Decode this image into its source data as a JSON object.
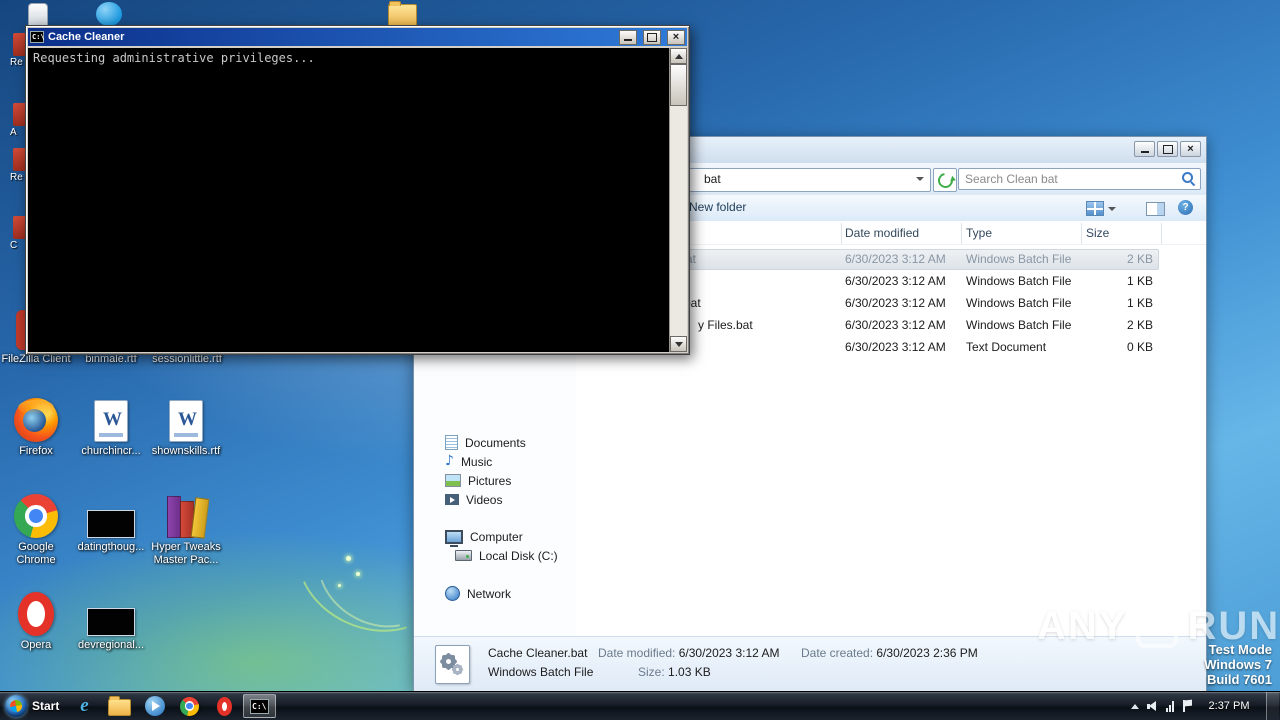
{
  "desktop": {
    "test_mode": {
      "l1": "Test Mode",
      "l2": "Windows 7",
      "l3": "Build 7601"
    },
    "watermark": {
      "left": "ANY",
      "right": "RUN"
    },
    "edge_fragments": [
      "Re",
      "A",
      "Re",
      "C"
    ],
    "icons": [
      {
        "label": "FileZilla Client",
        "icon": "filezilla-icon"
      },
      {
        "label": "binmale.rtf",
        "icon": "rtf-document-icon"
      },
      {
        "label": "sessionlittle.rtf",
        "icon": "rtf-document-icon"
      },
      {
        "label": "Firefox",
        "icon": "firefox-icon"
      },
      {
        "label": "churchincr...",
        "icon": "rtf-document-icon"
      },
      {
        "label": "shownskills.rtf",
        "icon": "rtf-document-icon"
      },
      {
        "label": "Google Chrome",
        "icon": "chrome-icon"
      },
      {
        "label": "datingthoug...",
        "icon": "image-thumbnail"
      },
      {
        "label": "Hyper Tweaks Master Pac...",
        "icon": "winrar-archive-icon"
      },
      {
        "label": "Opera",
        "icon": "opera-icon"
      },
      {
        "label": "devregional...",
        "icon": "image-thumbnail"
      }
    ]
  },
  "cmd": {
    "title": "Cache Cleaner",
    "output": "Requesting administrative privileges..."
  },
  "explorer": {
    "address_fragment": "bat",
    "search_placeholder": "Search Clean bat",
    "toolbar": {
      "new_folder": "New folder"
    },
    "columns": [
      "Date modified",
      "Type",
      "Size"
    ],
    "rows": [
      {
        "name_fragment": "at",
        "date": "6/30/2023 3:12 AM",
        "type": "Windows Batch File",
        "size": "2 KB",
        "selected": true
      },
      {
        "name_fragment": "",
        "date": "6/30/2023 3:12 AM",
        "type": "Windows Batch File",
        "size": "1 KB",
        "selected": false
      },
      {
        "name_fragment": "bat",
        "date": "6/30/2023 3:12 AM",
        "type": "Windows Batch File",
        "size": "1 KB",
        "selected": false
      },
      {
        "name_fragment": "y Files.bat",
        "date": "6/30/2023 3:12 AM",
        "type": "Windows Batch File",
        "size": "2 KB",
        "selected": false
      },
      {
        "name_fragment": "",
        "date": "6/30/2023 3:12 AM",
        "type": "Text Document",
        "size": "0 KB",
        "selected": false
      }
    ],
    "sidebar": [
      {
        "label": "Documents"
      },
      {
        "label": "Music"
      },
      {
        "label": "Pictures"
      },
      {
        "label": "Videos"
      },
      {
        "label": "Computer"
      },
      {
        "label": "Local Disk (C:)"
      },
      {
        "label": "Network"
      }
    ],
    "details": {
      "file_name": "Cache Cleaner.bat",
      "date_modified_label": "Date modified:",
      "date_modified": "6/30/2023 3:12 AM",
      "date_created_label": "Date created:",
      "date_created": "6/30/2023 2:36 PM",
      "file_type": "Windows Batch File",
      "size_label": "Size:",
      "size": "1.03 KB"
    }
  },
  "taskbar": {
    "start_label": "Start",
    "clock": "2:37 PM"
  },
  "colors": {
    "selection_row": "#e4e7ea",
    "cmd_title_start": "#0b2f8a",
    "cmd_title_end": "#2f7bd9",
    "taskbar": "#161c25",
    "search_refresh_green": "#3fae49"
  }
}
